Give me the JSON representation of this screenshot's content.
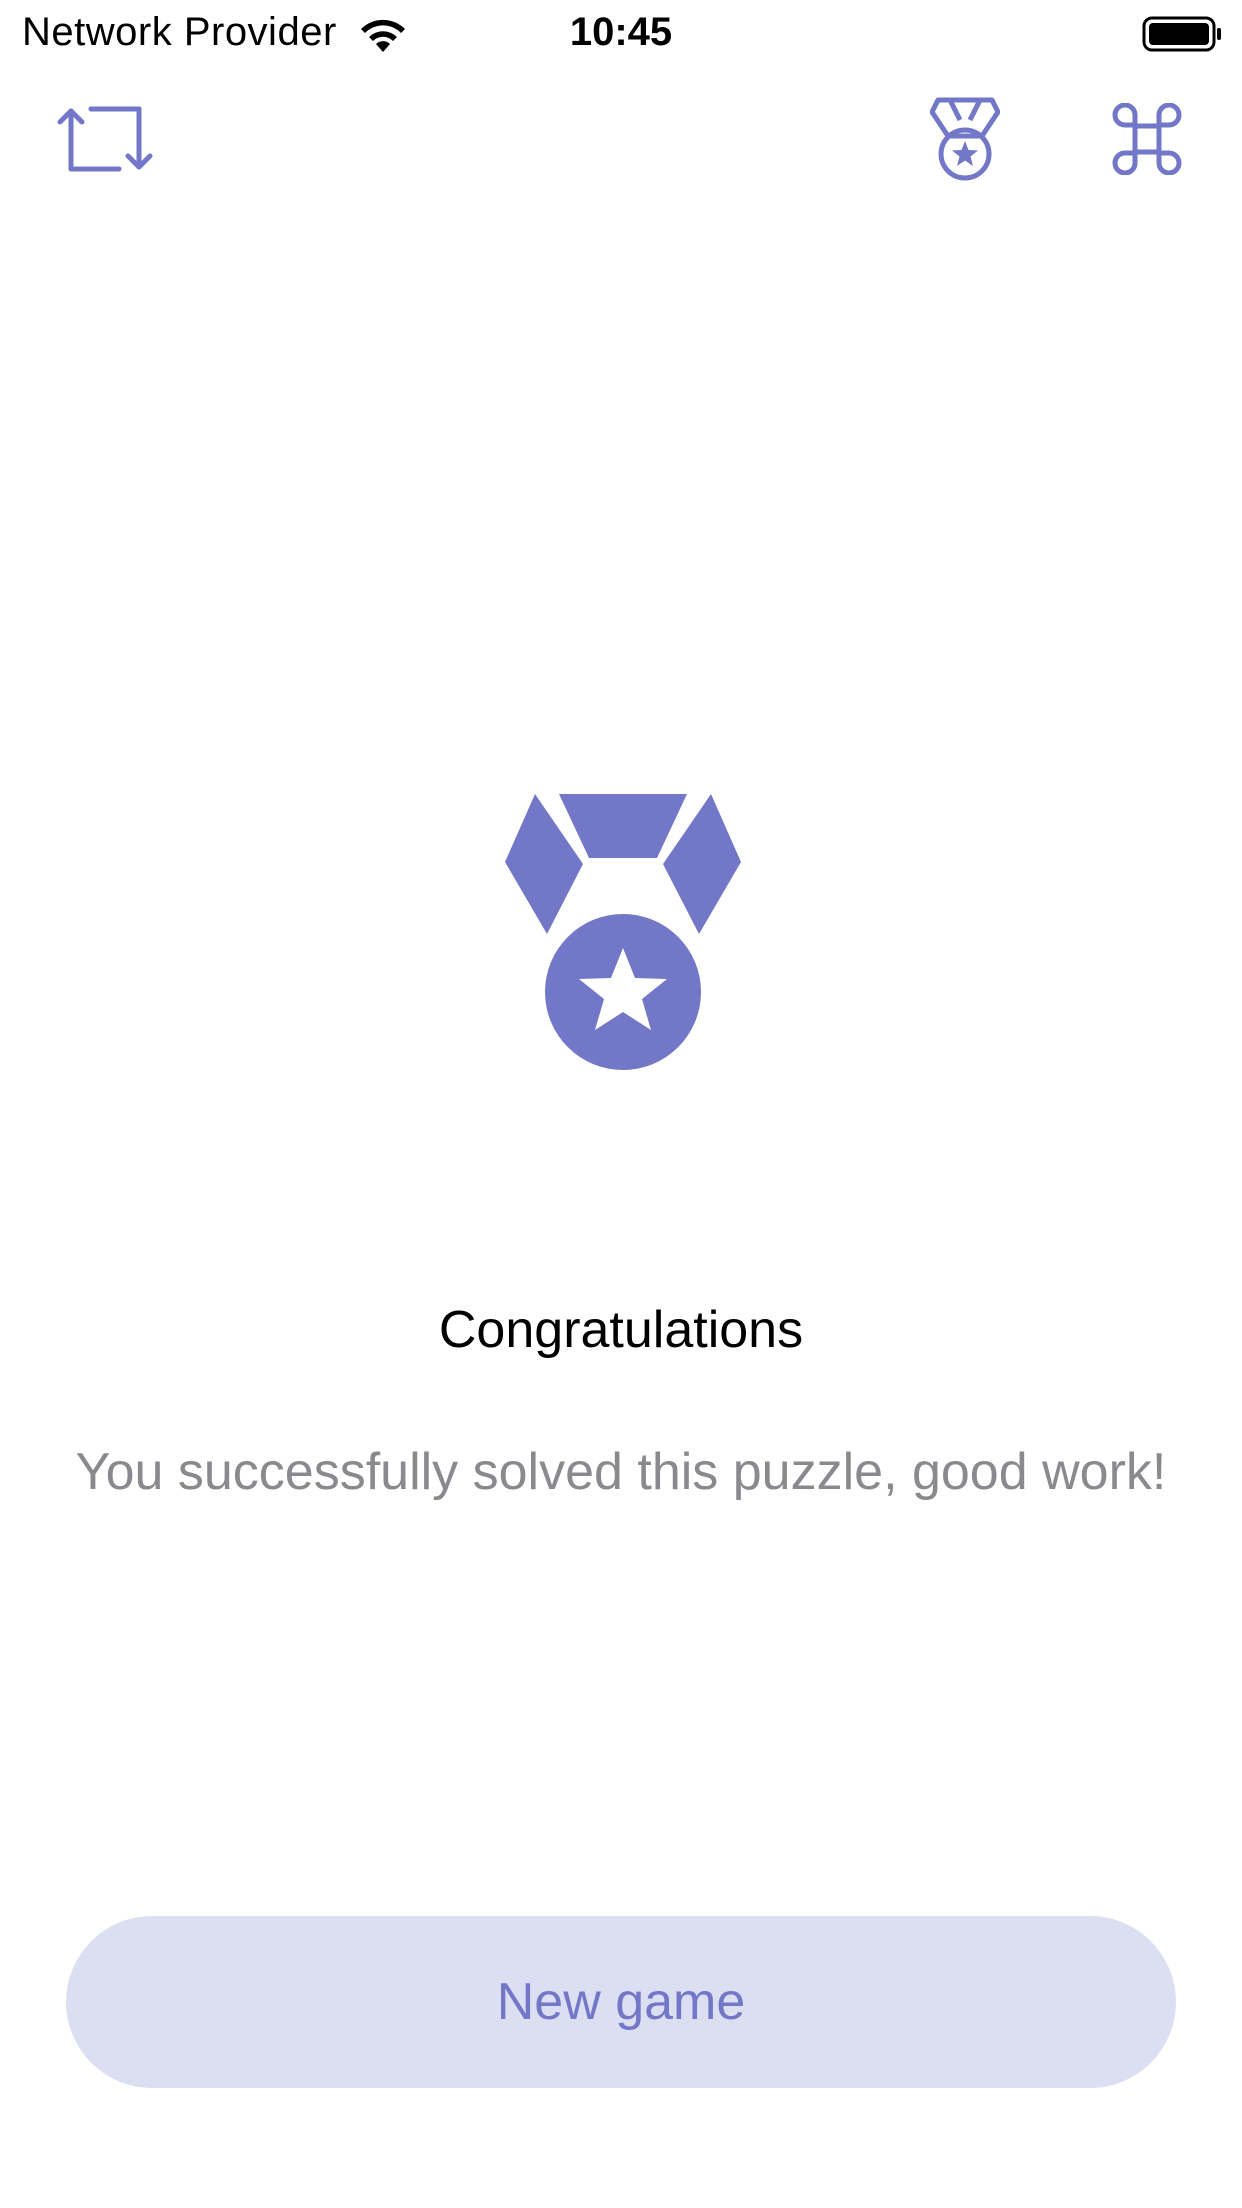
{
  "status_bar": {
    "carrier": "Network Provider",
    "time": "10:45"
  },
  "toolbar": {
    "left_icon": "refresh-arrows-icon",
    "right_icons": [
      "medal-icon",
      "command-icon"
    ]
  },
  "content": {
    "hero_icon": "medal-star-icon",
    "title": "Congratulations",
    "message": "You successfully solved this puzzle, good work!"
  },
  "actions": {
    "new_game_label": "New game"
  },
  "colors": {
    "accent": "#7277c7",
    "button_bg": "#dcdef1",
    "secondary_text": "#8a8a8e"
  }
}
